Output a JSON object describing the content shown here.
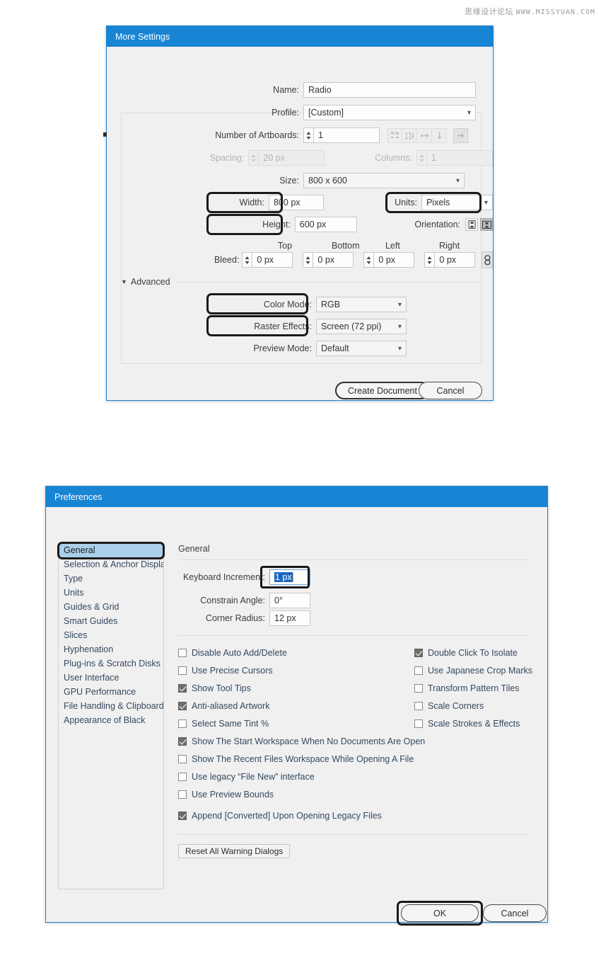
{
  "watermark": {
    "cn": "思缘设计论坛",
    "url": "WWW.MISSYUAN.COM"
  },
  "new_doc_dialog": {
    "title": "More Settings",
    "name_label": "Name:",
    "name_value": "Radio",
    "profile_label": "Profile:",
    "profile_value": "[Custom]",
    "artboards_label": "Number of Artboards:",
    "artboards_value": "1",
    "spacing_label": "Spacing:",
    "spacing_value": "20 px",
    "columns_label": "Columns:",
    "columns_value": "1",
    "size_label": "Size:",
    "size_value": "800 x 600",
    "width_label": "Width:",
    "width_value": "800 px",
    "height_label": "Height:",
    "height_value": "600 px",
    "units_label": "Units:",
    "units_value": "Pixels",
    "orientation_label": "Orientation:",
    "bleed_label": "Bleed:",
    "bleed_top_header": "Top",
    "bleed_bottom_header": "Bottom",
    "bleed_left_header": "Left",
    "bleed_right_header": "Right",
    "bleed_top": "0 px",
    "bleed_bottom": "0 px",
    "bleed_left": "0 px",
    "bleed_right": "0 px",
    "advanced_label": "Advanced",
    "color_mode_label": "Color Mode:",
    "color_mode_value": "RGB",
    "raster_label": "Raster Effects:",
    "raster_value": "Screen (72 ppi)",
    "preview_label": "Preview Mode:",
    "preview_value": "Default",
    "create_button": "Create Document",
    "cancel_button": "Cancel"
  },
  "preferences_dialog": {
    "title": "Preferences",
    "sidebar": [
      {
        "label": "General",
        "selected": true
      },
      {
        "label": "Selection & Anchor Display",
        "selected": false
      },
      {
        "label": "Type",
        "selected": false
      },
      {
        "label": "Units",
        "selected": false
      },
      {
        "label": "Guides & Grid",
        "selected": false
      },
      {
        "label": "Smart Guides",
        "selected": false
      },
      {
        "label": "Slices",
        "selected": false
      },
      {
        "label": "Hyphenation",
        "selected": false
      },
      {
        "label": "Plug-ins & Scratch Disks",
        "selected": false
      },
      {
        "label": "User Interface",
        "selected": false
      },
      {
        "label": "GPU Performance",
        "selected": false
      },
      {
        "label": "File Handling & Clipboard",
        "selected": false
      },
      {
        "label": "Appearance of Black",
        "selected": false
      }
    ],
    "section_title": "General",
    "keyboard_increment_label": "Keyboard Increment:",
    "keyboard_increment_value": "1 px",
    "constrain_angle_label": "Constrain Angle:",
    "constrain_angle_value": "0°",
    "corner_radius_label": "Corner Radius:",
    "corner_radius_value": "12 px",
    "checkboxes_left": [
      {
        "label": "Disable Auto Add/Delete",
        "checked": false
      },
      {
        "label": "Use Precise Cursors",
        "checked": false
      },
      {
        "label": "Show Tool Tips",
        "checked": true
      },
      {
        "label": "Anti-aliased Artwork",
        "checked": true
      },
      {
        "label": "Select Same Tint %",
        "checked": false
      },
      {
        "label": "Show The Start Workspace When No Documents Are Open",
        "checked": true
      },
      {
        "label": "Show The Recent Files Workspace While Opening A File",
        "checked": false
      },
      {
        "label": "Use legacy “File New” interface",
        "checked": false
      },
      {
        "label": "Use Preview Bounds",
        "checked": false
      },
      {
        "label": "Append [Converted] Upon Opening Legacy Files",
        "checked": true
      }
    ],
    "checkboxes_right": [
      {
        "label": "Double Click To Isolate",
        "checked": true
      },
      {
        "label": "Use Japanese Crop Marks",
        "checked": false
      },
      {
        "label": "Transform Pattern Tiles",
        "checked": false
      },
      {
        "label": "Scale Corners",
        "checked": false
      },
      {
        "label": "Scale Strokes & Effects",
        "checked": false
      }
    ],
    "reset_button": "Reset All Warning Dialogs",
    "ok_button": "OK",
    "cancel_button": "Cancel"
  },
  "colors": {
    "titlebar_blue": "#1884d4",
    "dialog_bg": "#f0f0f0",
    "selection_blue": "#aacfeb",
    "text_selection": "#1767c0",
    "highlight_outline": "#1a1a1a"
  }
}
